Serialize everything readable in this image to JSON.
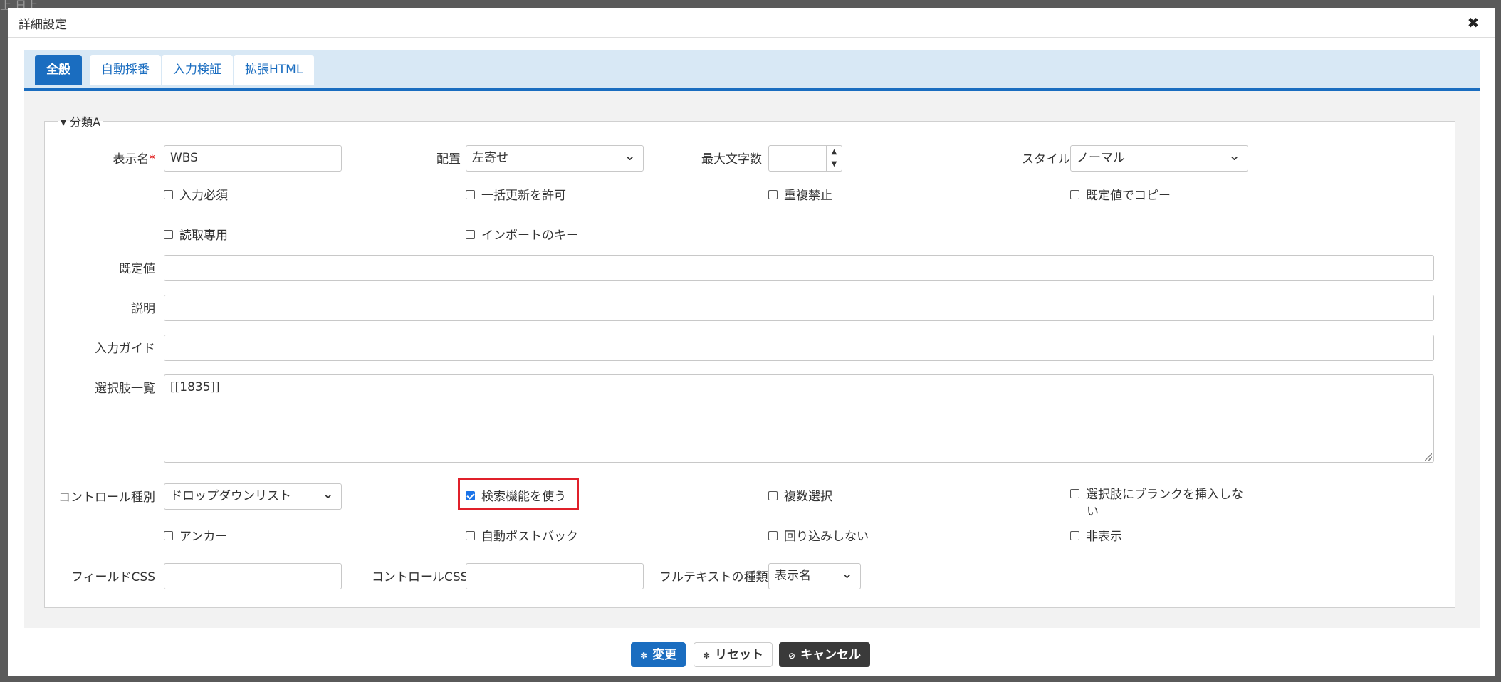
{
  "dialog": {
    "title": "詳細設定",
    "close_icon": "✖"
  },
  "tabs": [
    {
      "label": "全般",
      "active": true
    },
    {
      "label": "自動採番",
      "active": false
    },
    {
      "label": "入力検証",
      "active": false
    },
    {
      "label": "拡張HTML",
      "active": false
    }
  ],
  "group": {
    "legend": "▾ 分類A"
  },
  "fields": {
    "display_name_label": "表示名",
    "required_mark": "*",
    "display_name_value": "WBS",
    "alignment_label": "配置",
    "alignment_value": "左寄せ",
    "max_chars_label": "最大文字数",
    "max_chars_value": "",
    "style_label": "スタイル",
    "style_value": "ノーマル",
    "default_label": "既定値",
    "default_value": "",
    "description_label": "説明",
    "description_value": "",
    "input_guide_label": "入力ガイド",
    "input_guide_value": "",
    "choices_label": "選択肢一覧",
    "choices_value": "[[1835]]",
    "control_type_label": "コントロール種別",
    "control_type_value": "ドロップダウンリスト",
    "field_css_label": "フィールドCSS",
    "field_css_value": "",
    "control_css_label": "コントロールCSS",
    "control_css_value": "",
    "fulltext_label": "フルテキストの種類",
    "fulltext_value": "表示名"
  },
  "checkboxes": {
    "required": {
      "label": "入力必須",
      "checked": false
    },
    "bulk_update": {
      "label": "一括更新を許可",
      "checked": false
    },
    "no_duplicate": {
      "label": "重複禁止",
      "checked": false
    },
    "copy_default": {
      "label": "既定値でコピー",
      "checked": false
    },
    "read_only": {
      "label": "読取専用",
      "checked": false
    },
    "import_key": {
      "label": "インポートのキー",
      "checked": false
    },
    "use_search": {
      "label": "検索機能を使う",
      "checked": true
    },
    "multiple": {
      "label": "複数選択",
      "checked": false
    },
    "no_blank_line1": "選択肢にブランクを挿入しな",
    "no_blank_line2": "い",
    "anchor": {
      "label": "アンカー",
      "checked": false
    },
    "auto_postback": {
      "label": "自動ポストバック",
      "checked": false
    },
    "no_wrap": {
      "label": "回り込みしない",
      "checked": false
    },
    "hidden": {
      "label": "非表示",
      "checked": false
    }
  },
  "buttons": {
    "change": "変更",
    "reset": "リセット",
    "cancel": "キャンセル",
    "change_icon": "✽",
    "reset_icon": "✽",
    "cancel_icon": "⊘"
  },
  "colors": {
    "accent": "#1a6dc0",
    "highlight": "#e0202a"
  }
}
